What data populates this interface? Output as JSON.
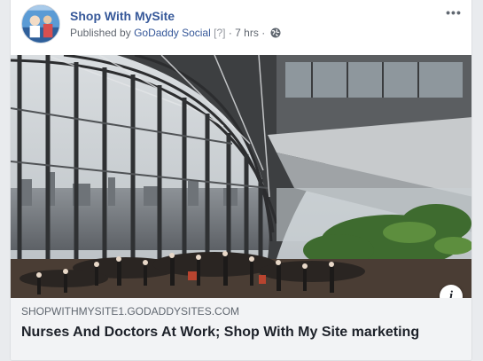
{
  "post": {
    "page_name": "Shop With MySite",
    "published_by_prefix": "Published by",
    "publisher": "GoDaddy Social",
    "help_marker": "[?]",
    "separator": "·",
    "time": "7 hrs",
    "more_label": "•••"
  },
  "link": {
    "domain": "SHOPWITHMYSITE1.GODADDYSITES.COM",
    "title": "Nurses And Doctors At Work; Shop With My Site marketing",
    "info_label": "i"
  },
  "icons": {
    "audience": "globe-icon",
    "options": "more-options-icon",
    "info": "info-icon"
  },
  "colors": {
    "link_blue": "#365899",
    "meta_gray": "#616770",
    "link_box_bg": "#f2f3f5",
    "title_text": "#1d2129"
  }
}
